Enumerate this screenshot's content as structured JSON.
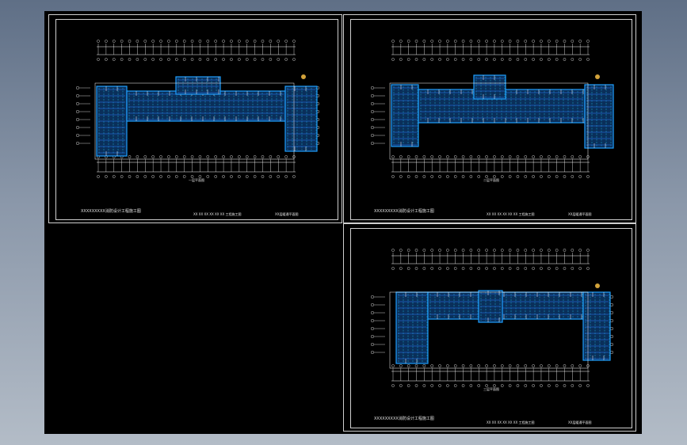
{
  "app": {
    "window_title": ""
  },
  "viewport": {
    "background": "#000000",
    "drawing_color": "#1ea0ff",
    "line_color": "#ffffff"
  },
  "sheets": [
    {
      "id": "sheet-1",
      "title_block": {
        "main": "XXXXXXXXX消防设计工程施工图",
        "project": "XX XX XX XX XX XX 工程施工图",
        "drawing": "XX层暖通平面图"
      },
      "plan_label": "一层平面图"
    },
    {
      "id": "sheet-2",
      "title_block": {
        "main": "XXXXXXXXX消防设计工程施工图",
        "project": "XX XX XX XX XX XX 工程施工图",
        "drawing": "XX层暖通平面图"
      },
      "plan_label": "二层平面图"
    },
    {
      "id": "sheet-3",
      "title_block": {
        "main": "XXXXXXXXX消防设计工程施工图",
        "project": "XX XX XX XX XX XX 工程施工图",
        "drawing": "XX层暖通平面图"
      },
      "plan_label": "三层平面图"
    }
  ]
}
